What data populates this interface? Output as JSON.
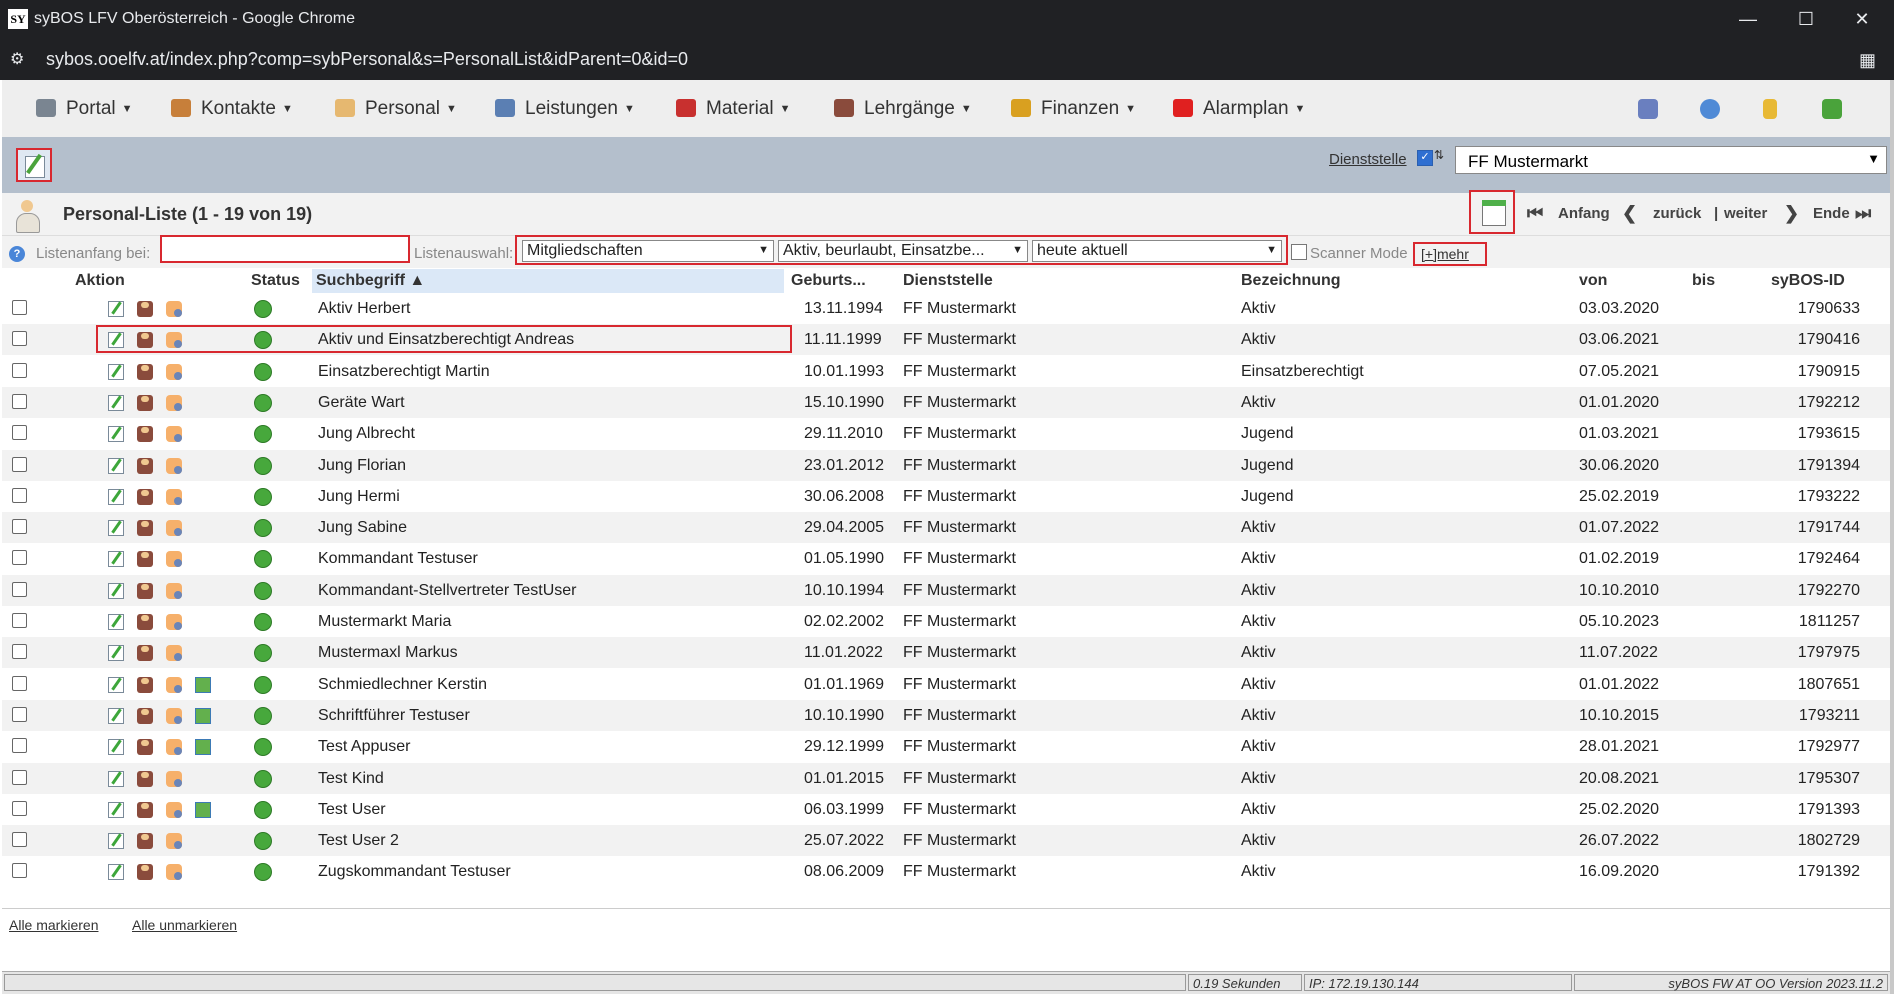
{
  "window": {
    "app_icon": "SY",
    "title": "syBOS LFV Oberösterreich - Google Chrome",
    "url": "sybos.ooelfv.at/index.php?comp=sybPersonal&s=PersonalList&idParent=0&id=0"
  },
  "menu": {
    "items": [
      {
        "label": "Portal",
        "icon": "portal-icon",
        "color": "#7a8591"
      },
      {
        "label": "Kontakte",
        "icon": "contacts-icon",
        "color": "#c77f3a"
      },
      {
        "label": "Personal",
        "icon": "person-icon",
        "color": "#e6b870"
      },
      {
        "label": "Leistungen",
        "icon": "gear-icon",
        "color": "#5b7fb3"
      },
      {
        "label": "Material",
        "icon": "truck-icon",
        "color": "#c8302f"
      },
      {
        "label": "Lehrgänge",
        "icon": "firefighter-icon",
        "color": "#8a4b3c"
      },
      {
        "label": "Finanzen",
        "icon": "money-icon",
        "color": "#d9a020"
      },
      {
        "label": "Alarmplan",
        "icon": "alarm-icon",
        "color": "#e02020"
      }
    ],
    "right_icons": [
      "users-icon",
      "info-icon",
      "notebook-icon",
      "logout-icon"
    ]
  },
  "toolbar": {
    "dienststelle_label": "Dienststelle",
    "dienststelle_checked_mark": "✓",
    "dienststelle_sym": "⇅",
    "dienststelle_value": "FF Mustermarkt"
  },
  "list": {
    "title": "Personal-Liste (1 - 19 von 19)",
    "nav": {
      "first": "Anfang",
      "prev": "zurück",
      "sep": "|",
      "next": "weiter",
      "last": "Ende"
    }
  },
  "filters": {
    "listenanfang_label": "Listenanfang bei:",
    "listenanfang_value": "",
    "listenauswahl_label": "Listenauswahl:",
    "select1": "Mitgliedschaften",
    "select2": "Aktiv, beurlaubt, Einsatzbe...",
    "select3": "heute aktuell",
    "scanner_label": "Scanner Mode",
    "mehr": "[+]mehr"
  },
  "table": {
    "headers": {
      "aktion": "Aktion",
      "status": "Status",
      "suchbegriff": "Suchbegriff ▲",
      "geburts": "Geburts...",
      "dienststelle": "Dienststelle",
      "bezeichnung": "Bezeichnung",
      "von": "von",
      "bis": "bis",
      "sybos_id": "syBOS-ID"
    },
    "rows": [
      {
        "name": "Aktiv Herbert",
        "birth": "13.11.1994",
        "dienst": "FF Mustermarkt",
        "bez": "Aktiv",
        "von": "03.03.2020",
        "bis": "",
        "id": "1790633",
        "img": false
      },
      {
        "name": "Aktiv und Einsatzberechtigt Andreas",
        "birth": "11.11.1999",
        "dienst": "FF Mustermarkt",
        "bez": "Aktiv",
        "von": "03.06.2021",
        "bis": "",
        "id": "1790416",
        "img": false
      },
      {
        "name": "Einsatzberechtigt Martin",
        "birth": "10.01.1993",
        "dienst": "FF Mustermarkt",
        "bez": "Einsatzberechtigt",
        "von": "07.05.2021",
        "bis": "",
        "id": "1790915",
        "img": false
      },
      {
        "name": "Geräte Wart",
        "birth": "15.10.1990",
        "dienst": "FF Mustermarkt",
        "bez": "Aktiv",
        "von": "01.01.2020",
        "bis": "",
        "id": "1792212",
        "img": false
      },
      {
        "name": "Jung Albrecht",
        "birth": "29.11.2010",
        "dienst": "FF Mustermarkt",
        "bez": "Jugend",
        "von": "01.03.2021",
        "bis": "",
        "id": "1793615",
        "img": false
      },
      {
        "name": "Jung Florian",
        "birth": "23.01.2012",
        "dienst": "FF Mustermarkt",
        "bez": "Jugend",
        "von": "30.06.2020",
        "bis": "",
        "id": "1791394",
        "img": false
      },
      {
        "name": "Jung Hermi",
        "birth": "30.06.2008",
        "dienst": "FF Mustermarkt",
        "bez": "Jugend",
        "von": "25.02.2019",
        "bis": "",
        "id": "1793222",
        "img": false
      },
      {
        "name": "Jung Sabine",
        "birth": "29.04.2005",
        "dienst": "FF Mustermarkt",
        "bez": "Aktiv",
        "von": "01.07.2022",
        "bis": "",
        "id": "1791744",
        "img": false
      },
      {
        "name": "Kommandant Testuser",
        "birth": "01.05.1990",
        "dienst": "FF Mustermarkt",
        "bez": "Aktiv",
        "von": "01.02.2019",
        "bis": "",
        "id": "1792464",
        "img": false
      },
      {
        "name": "Kommandant-Stellvertreter TestUser",
        "birth": "10.10.1994",
        "dienst": "FF Mustermarkt",
        "bez": "Aktiv",
        "von": "10.10.2010",
        "bis": "",
        "id": "1792270",
        "img": false
      },
      {
        "name": "Mustermarkt Maria",
        "birth": "02.02.2002",
        "dienst": "FF Mustermarkt",
        "bez": "Aktiv",
        "von": "05.10.2023",
        "bis": "",
        "id": "1811257",
        "img": false
      },
      {
        "name": "Mustermaxl Markus",
        "birth": "11.01.2022",
        "dienst": "FF Mustermarkt",
        "bez": "Aktiv",
        "von": "11.07.2022",
        "bis": "",
        "id": "1797975",
        "img": false
      },
      {
        "name": "Schmiedlechner Kerstin",
        "birth": "01.01.1969",
        "dienst": "FF Mustermarkt",
        "bez": "Aktiv",
        "von": "01.01.2022",
        "bis": "",
        "id": "1807651",
        "img": true
      },
      {
        "name": "Schriftführer Testuser",
        "birth": "10.10.1990",
        "dienst": "FF Mustermarkt",
        "bez": "Aktiv",
        "von": "10.10.2015",
        "bis": "",
        "id": "1793211",
        "img": true
      },
      {
        "name": "Test Appuser",
        "birth": "29.12.1999",
        "dienst": "FF Mustermarkt",
        "bez": "Aktiv",
        "von": "28.01.2021",
        "bis": "",
        "id": "1792977",
        "img": true
      },
      {
        "name": "Test Kind",
        "birth": "01.01.2015",
        "dienst": "FF Mustermarkt",
        "bez": "Aktiv",
        "von": "20.08.2021",
        "bis": "",
        "id": "1795307",
        "img": false
      },
      {
        "name": "Test User",
        "birth": "06.03.1999",
        "dienst": "FF Mustermarkt",
        "bez": "Aktiv",
        "von": "25.02.2020",
        "bis": "",
        "id": "1791393",
        "img": true
      },
      {
        "name": "Test User 2",
        "birth": "25.07.2022",
        "dienst": "FF Mustermarkt",
        "bez": "Aktiv",
        "von": "26.07.2022",
        "bis": "",
        "id": "1802729",
        "img": false
      },
      {
        "name": "Zugskommandant Testuser",
        "birth": "08.06.2009",
        "dienst": "FF Mustermarkt",
        "bez": "Aktiv",
        "von": "16.09.2020",
        "bis": "",
        "id": "1791392",
        "img": false
      }
    ]
  },
  "footer": {
    "mark_all": "Alle markieren",
    "unmark_all": "Alle unmarkieren",
    "time": "0.19 Sekunden",
    "ip": "IP: 172.19.130.144",
    "version": "syBOS FW AT OO Version 2023.11.2"
  },
  "colors": {
    "highlight_red": "#d8282f",
    "status_green": "#47a83c",
    "toolbar_blue": "#b4bfcc"
  }
}
